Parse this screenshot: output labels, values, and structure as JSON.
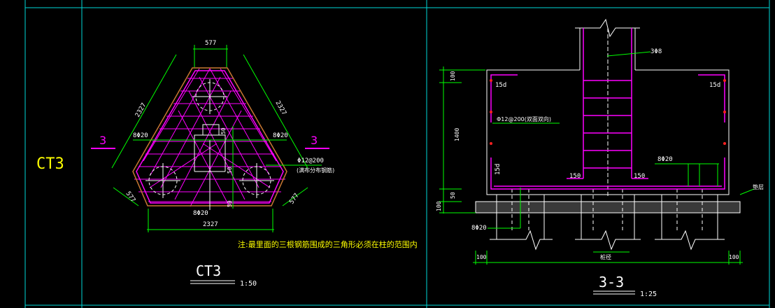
{
  "app": {
    "background": "#000000"
  },
  "colors": {
    "frame": "#00d7d7",
    "dimension": "#00ff00",
    "rebar": "#ff00ff",
    "outline": "#ffffff",
    "note": "#ffff00",
    "concrete_edge": "#c87832",
    "red_marks": "#ff2020"
  },
  "left_panel": {
    "ct_label": "CT3"
  },
  "plan": {
    "dims": {
      "top": "577",
      "left_side": "2327",
      "right_side": "2327",
      "bottom": "2327",
      "bl_corner": "577",
      "br_corner": "577",
      "d50_a": "50",
      "d50_b": "50",
      "d50_c": "50"
    },
    "rebar": {
      "left": "8Φ20",
      "right": "8Φ20",
      "bottom": "8Φ20",
      "distributed": "Φ12@200",
      "distributed_note": "(满布分布钢筋)"
    },
    "section_marks": {
      "left": "3",
      "right": "3"
    },
    "note": "注:最里面的三根钢筋围成的三角形必须在柱的范围内",
    "title": "CT3",
    "scale": "1:50"
  },
  "section": {
    "dims": {
      "top": "100",
      "height": "1400",
      "lower": "50",
      "base": "100",
      "left_edge": "100",
      "right_edge": "100"
    },
    "labels": {
      "stirrup": "3Φ8",
      "tl_anchor": "15d",
      "tr_anchor": "15d",
      "side_anchor": "15d",
      "bl_anchor": "150",
      "br_anchor": "150",
      "mesh": "Φ12@200(双面双向)",
      "rebar_right": "8Φ20",
      "rebar_bottom": "8Φ20",
      "bedding": "垫层",
      "pile": "桩径"
    },
    "title": "3-3",
    "scale": "1:25"
  }
}
